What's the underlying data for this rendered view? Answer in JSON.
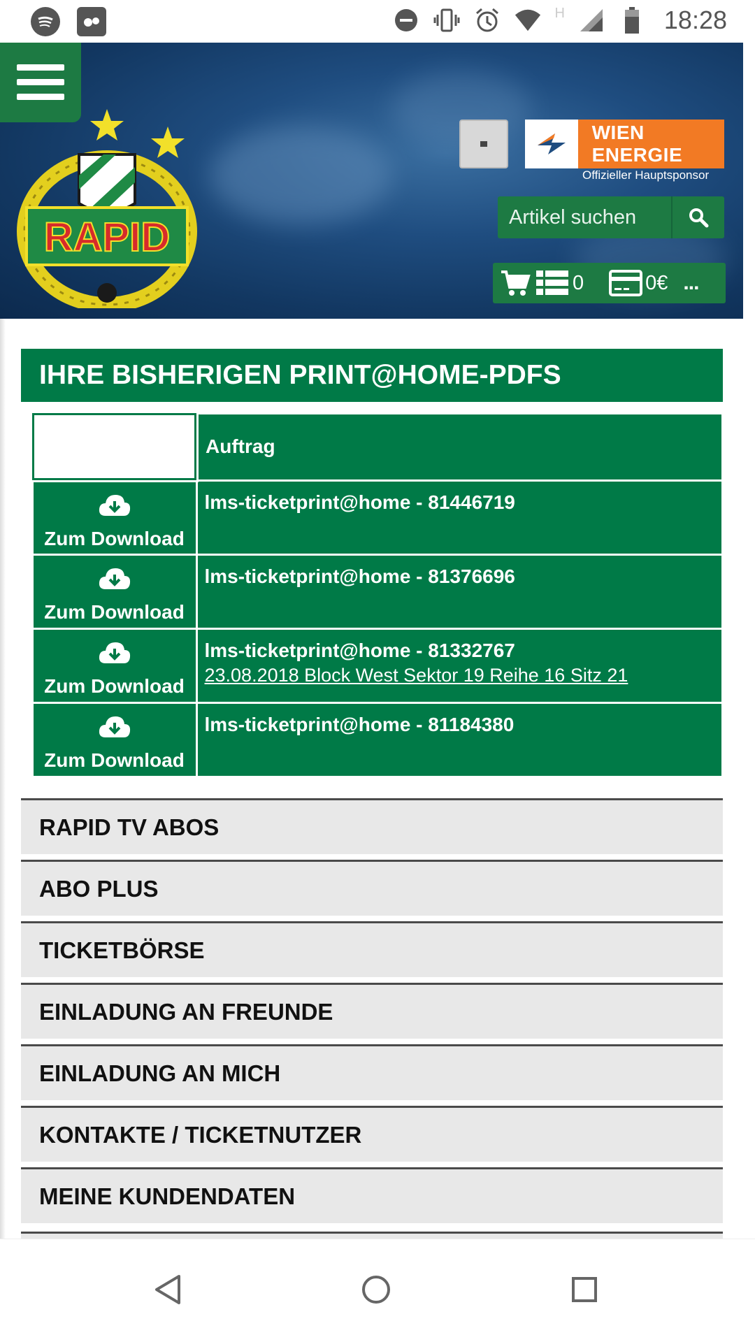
{
  "status_bar": {
    "time": "18:28",
    "left_icons": [
      "spotify-icon",
      "photo-app-icon"
    ],
    "right_icons": [
      "do-not-disturb-icon",
      "vibrate-icon",
      "alarm-icon",
      "wifi-icon",
      "h-signal-icon",
      "cell-signal-icon",
      "battery-icon"
    ],
    "network_letter": "H"
  },
  "header": {
    "logo_text": "RAPID",
    "sponsor_name": "WIEN ENERGIE",
    "sponsor_caption": "Offizieller Hauptsponsor",
    "search": {
      "placeholder": "Artikel suchen"
    },
    "cart": {
      "list_count": "0",
      "amount": "0€",
      "more": "..."
    }
  },
  "main": {
    "title": "IHRE BISHERIGEN PRINT@HOME-PDFS",
    "table": {
      "column_header": "Auftrag",
      "rows": [
        {
          "download_label": "Zum Download",
          "order": "lms-ticketprint@home - 81446719",
          "detail": ""
        },
        {
          "download_label": "Zum Download",
          "order": "lms-ticketprint@home - 81376696",
          "detail": ""
        },
        {
          "download_label": "Zum Download",
          "order": "lms-ticketprint@home - 81332767",
          "detail": "23.08.2018   Block  West  Sektor  19  Reihe  16  Sitz  21"
        },
        {
          "download_label": "Zum Download",
          "order": "lms-ticketprint@home - 81184380",
          "detail": ""
        }
      ]
    },
    "menu": [
      "RAPID TV ABOS",
      "ABO PLUS",
      "TICKETBÖRSE",
      "EINLADUNG AN FREUNDE",
      "EINLADUNG AN MICH",
      "KONTAKTE / TICKETNUTZER",
      "MEINE KUNDENDATEN"
    ]
  },
  "colors": {
    "primary_green": "#007a47",
    "button_green": "#1d7a43",
    "sponsor_orange": "#f27a24",
    "header_blue": "#1f4d80",
    "menu_bg": "#e8e8e8"
  }
}
